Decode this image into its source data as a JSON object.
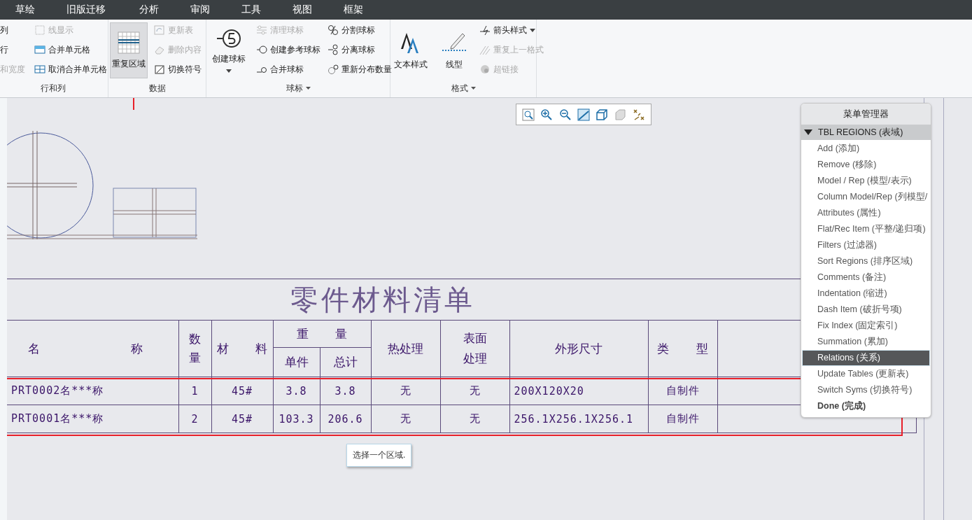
{
  "menu_tabs": [
    "草绘",
    "旧版迁移",
    "分析",
    "审阅",
    "工具",
    "视图",
    "框架"
  ],
  "ribbon": [
    {
      "label": "行和列",
      "has_menu": false,
      "columns": [
        [
          {
            "kind": "small",
            "label": "列",
            "disabled": false,
            "dropdown": false
          },
          {
            "kind": "small",
            "label": "行",
            "disabled": false,
            "dropdown": false
          },
          {
            "kind": "small",
            "label": "和宽度",
            "disabled": true,
            "dropdown": false
          }
        ],
        [
          {
            "kind": "small",
            "label": "线显示",
            "disabled": true,
            "dropdown": false
          },
          {
            "kind": "small",
            "label": "合并单元格",
            "disabled": false,
            "dropdown": false
          },
          {
            "kind": "small",
            "label": "取消合并单元格",
            "disabled": false,
            "dropdown": false
          }
        ]
      ]
    },
    {
      "label": "数据",
      "has_menu": false,
      "columns": [
        [
          {
            "kind": "large",
            "label": "重复区域",
            "pressed": true,
            "dropdown": false
          }
        ],
        [
          {
            "kind": "small",
            "label": "更新表",
            "disabled": true,
            "dropdown": false
          },
          {
            "kind": "small",
            "label": "删除内容",
            "disabled": true,
            "dropdown": false
          },
          {
            "kind": "small",
            "label": "切换符号",
            "disabled": false,
            "dropdown": false
          }
        ]
      ]
    },
    {
      "label": "球标",
      "has_menu": true,
      "columns": [
        [
          {
            "kind": "large",
            "label": "创建球标",
            "pressed": false,
            "dropdown": true
          }
        ],
        [
          {
            "kind": "small",
            "label": "清理球标",
            "disabled": true,
            "dropdown": false
          },
          {
            "kind": "small",
            "label": "创建参考球标",
            "disabled": false,
            "dropdown": false
          },
          {
            "kind": "small",
            "label": "合并球标",
            "disabled": false,
            "dropdown": false
          }
        ],
        [
          {
            "kind": "small",
            "label": "分割球标",
            "disabled": false,
            "dropdown": false
          },
          {
            "kind": "small",
            "label": "分离球标",
            "disabled": false,
            "dropdown": false
          },
          {
            "kind": "small",
            "label": "重新分布数量",
            "disabled": false,
            "dropdown": false
          }
        ]
      ]
    },
    {
      "label": "格式",
      "has_menu": true,
      "columns": [
        [
          {
            "kind": "large",
            "label": "文本样式",
            "pressed": false,
            "dropdown": false
          }
        ],
        [
          {
            "kind": "large",
            "label": "线型",
            "pressed": false,
            "dropdown": false
          }
        ],
        [
          {
            "kind": "small",
            "label": "箭头样式",
            "disabled": false,
            "dropdown": true
          },
          {
            "kind": "small",
            "label": "重复上一格式",
            "disabled": true,
            "dropdown": false
          },
          {
            "kind": "small",
            "label": "超链接",
            "disabled": true,
            "dropdown": false
          }
        ]
      ]
    }
  ],
  "table": {
    "title": "零件材料清单",
    "headers": {
      "name": "名 称",
      "qty": "数量",
      "material": "材 料",
      "weight": "重 量",
      "unit": "单件",
      "total": "总计",
      "heat": "热处理",
      "surface": "表面处理",
      "size": "外形尺寸",
      "type": "类 型"
    },
    "rows": [
      {
        "name": "PRT0002名***称",
        "qty": "1",
        "material": "45#",
        "unit": "3.8",
        "total": "3.8",
        "heat": "无",
        "surface": "无",
        "size": "200X120X20",
        "type": "自制件"
      },
      {
        "name": "PRT0001名***称",
        "qty": "2",
        "material": "45#",
        "unit": "103.3",
        "total": "206.6",
        "heat": "无",
        "surface": "无",
        "size": "256.1X256.1X256.1",
        "type": "自制件"
      }
    ]
  },
  "tooltip": "选择一个区域.",
  "menu_manager": {
    "title": "菜单管理器",
    "section": {
      "label": "TBL REGIONS (表域)",
      "expanded": true
    },
    "items": [
      {
        "label": "Add (添加)",
        "kind": "normal",
        "selected": false
      },
      {
        "label": "Remove (移除)",
        "kind": "normal",
        "selected": false
      },
      {
        "label": "Model / Rep (模型/表示)",
        "kind": "normal",
        "selected": false
      },
      {
        "label": "Column Model/Rep (列模型/",
        "kind": "normal",
        "selected": false
      },
      {
        "label": "Attributes (属性)",
        "kind": "normal",
        "selected": false
      },
      {
        "label": "Flat/Rec Item (平整/递归项)",
        "kind": "normal",
        "selected": false
      },
      {
        "label": "Filters (过滤器)",
        "kind": "normal",
        "selected": false
      },
      {
        "label": "Sort Regions (排序区域)",
        "kind": "normal",
        "selected": false
      },
      {
        "label": "Comments (备注)",
        "kind": "normal",
        "selected": false
      },
      {
        "label": "Indentation (缩进)",
        "kind": "normal",
        "selected": false
      },
      {
        "label": "Dash Item (破折号项)",
        "kind": "normal",
        "selected": false
      },
      {
        "label": "Fix Index (固定索引)",
        "kind": "normal",
        "selected": false
      },
      {
        "label": "Summation (累加)",
        "kind": "normal",
        "selected": false
      },
      {
        "label": "Relations (关系)",
        "kind": "normal",
        "selected": true
      },
      {
        "label": "Update Tables (更新表)",
        "kind": "normal",
        "selected": false
      },
      {
        "label": "Switch Syms (切换符号)",
        "kind": "normal",
        "selected": false
      },
      {
        "label": "Done (完成)",
        "kind": "done",
        "selected": false
      }
    ]
  }
}
